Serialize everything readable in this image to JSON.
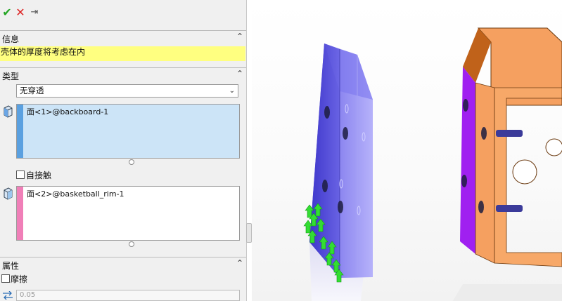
{
  "toolbar": {
    "ok_glyph": "✔",
    "cancel_glyph": "✕",
    "pin_glyph": "⇥"
  },
  "info": {
    "title": "信息",
    "message": "壳体的厚度将考虑在内",
    "collapse_glyph": "⌃"
  },
  "type": {
    "title": "类型",
    "collapse_glyph": "⌃",
    "selected": "无穿透",
    "arrow_glyph": "⌄",
    "set1_items": [
      "面<1>@backboard-1"
    ],
    "set1_color": "#5aa0e0",
    "self_contact_label": "自接触",
    "self_contact_checked": false,
    "set2_items": [
      "面<2>@basketball_rim-1"
    ],
    "set2_color": "#f07fb8"
  },
  "properties": {
    "title": "属性",
    "collapse_glyph": "⌃",
    "friction_label": "摩擦",
    "friction_checked": false,
    "friction_value": "0.05"
  },
  "colors": {
    "info_highlight": "#ffff80",
    "backboard": "#5a52d8",
    "rim_face": "#a020f0",
    "rim_frame": "#f5a060",
    "fixture_arrows": "#33dd33"
  }
}
